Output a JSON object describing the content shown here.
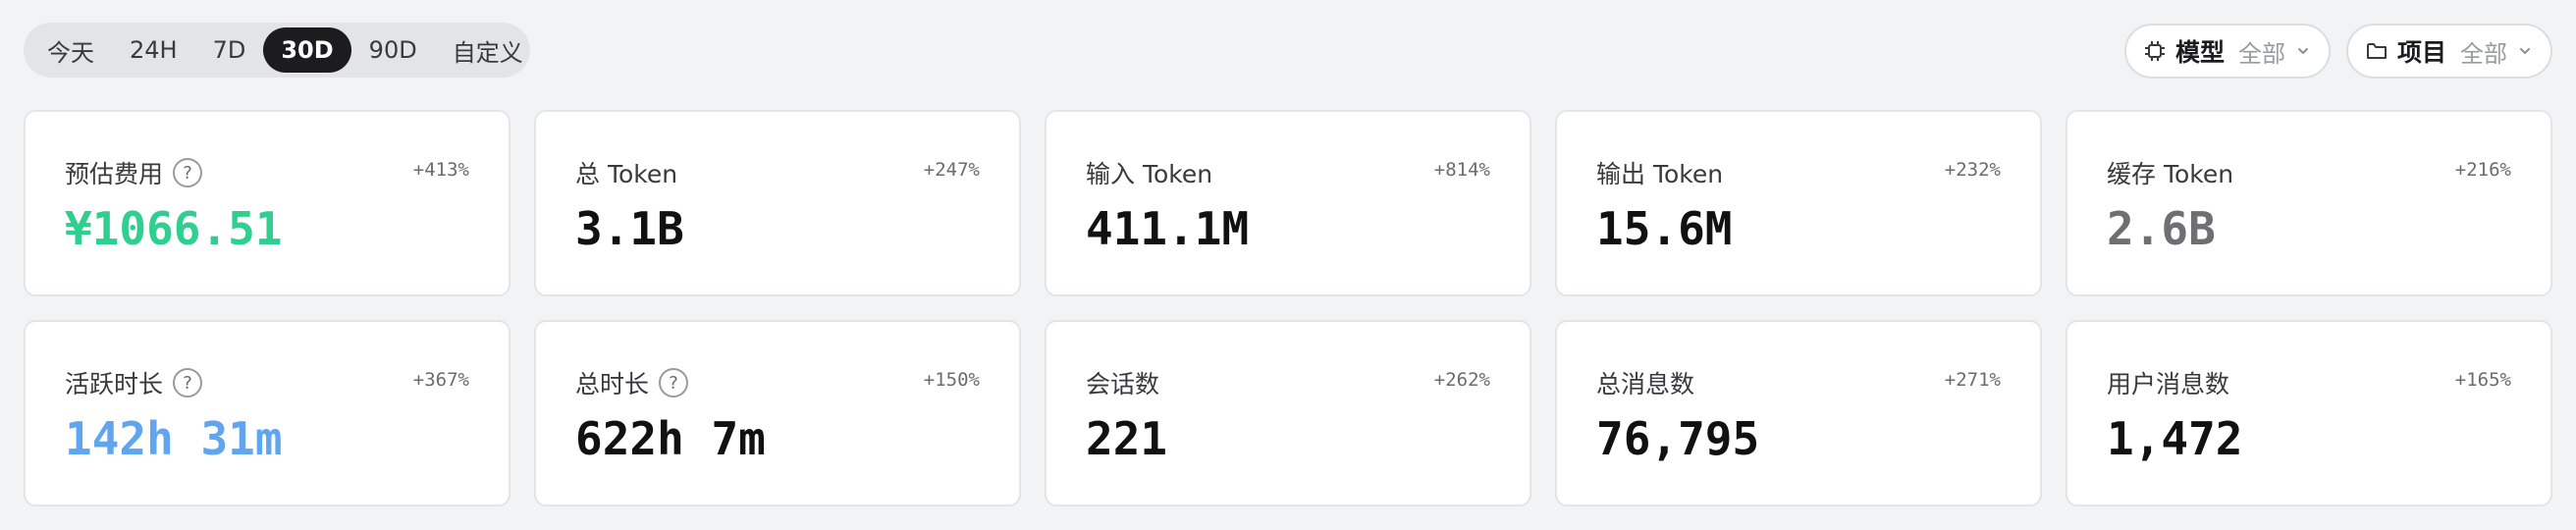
{
  "range_tabs": [
    {
      "label": "今天"
    },
    {
      "label": "24H"
    },
    {
      "label": "7D"
    },
    {
      "label": "30D"
    },
    {
      "label": "90D"
    },
    {
      "label": "自定义"
    }
  ],
  "active_range": "30D",
  "filters": {
    "model": {
      "label": "模型",
      "value": "全部",
      "icon": "chip-icon"
    },
    "project": {
      "label": "项目",
      "value": "全部",
      "icon": "folder-icon"
    }
  },
  "cards": [
    {
      "title": "预估费用",
      "has_help": true,
      "delta": "+413%",
      "value": "¥1066.51",
      "value_color": "#2fcf8f"
    },
    {
      "title": "总 Token",
      "has_help": false,
      "delta": "+247%",
      "value": "3.1B",
      "value_color": "#111111"
    },
    {
      "title": "输入 Token",
      "has_help": false,
      "delta": "+814%",
      "value": "411.1M",
      "value_color": "#111111"
    },
    {
      "title": "输出 Token",
      "has_help": false,
      "delta": "+232%",
      "value": "15.6M",
      "value_color": "#111111"
    },
    {
      "title": "缓存 Token",
      "has_help": false,
      "delta": "+216%",
      "value": "2.6B",
      "value_color": "#6e6e73"
    },
    {
      "title": "活跃时长",
      "has_help": true,
      "delta": "+367%",
      "value": "142h 31m",
      "value_color": "#5fa5f0"
    },
    {
      "title": "总时长",
      "has_help": true,
      "delta": "+150%",
      "value": "622h 7m",
      "value_color": "#111111"
    },
    {
      "title": "会话数",
      "has_help": false,
      "delta": "+262%",
      "value": "221",
      "value_color": "#111111"
    },
    {
      "title": "总消息数",
      "has_help": false,
      "delta": "+271%",
      "value": "76,795",
      "value_color": "#111111"
    },
    {
      "title": "用户消息数",
      "has_help": false,
      "delta": "+165%",
      "value": "1,472",
      "value_color": "#111111"
    }
  ],
  "help_glyph": "?"
}
